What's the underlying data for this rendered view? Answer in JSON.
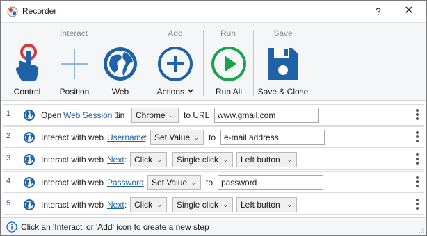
{
  "window": {
    "title": "Recorder",
    "help_label": "?",
    "close_label": "✕"
  },
  "ribbon": {
    "groups": {
      "interact": "Interact",
      "add": "Add",
      "run": "Run",
      "save": "Save"
    },
    "buttons": {
      "control": "Control",
      "position": "Position",
      "web": "Web",
      "actions": "Actions",
      "run_all": "Run All",
      "save_close": "Save & Close"
    },
    "actions_chevron": "⌄"
  },
  "steps": [
    {
      "num": "1",
      "prefix": "Open",
      "link": "Web Session 1",
      "mid": "in",
      "select": "Chrome",
      "suffix": "to URL",
      "value": "www.gmail.com"
    },
    {
      "num": "2",
      "prefix": "Interact with web",
      "link": "Username",
      "colon": ":",
      "select": "Set Value",
      "suffix": "to",
      "value": "e-mail address"
    },
    {
      "num": "3",
      "prefix": "Interact with web",
      "link": "Next",
      "colon": ":",
      "select": "Click",
      "select2": "Single click",
      "select3": "Left button"
    },
    {
      "num": "4",
      "prefix": "Interact with web",
      "link": "Password",
      "colon": ":",
      "select": "Set Value",
      "suffix": "to",
      "value": "password"
    },
    {
      "num": "5",
      "prefix": "Interact with web",
      "link": "Next",
      "colon": ":",
      "select": "Click",
      "select2": "Single click",
      "select3": "Left button"
    }
  ],
  "status": {
    "message": "Click an 'Interact' or 'Add' icon to create a new step"
  },
  "colors": {
    "accent": "#1e62a8",
    "run_green": "#1aa34a",
    "ribbon_bg": "#f5f6f7"
  }
}
